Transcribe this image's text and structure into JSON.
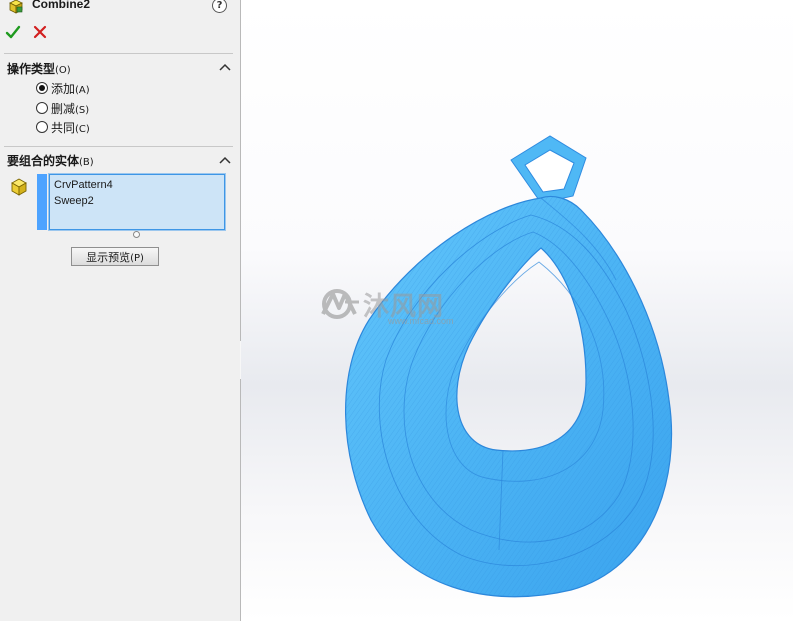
{
  "feature": {
    "title": "Combine2",
    "icon": "combine-feature-icon",
    "help_label": "?"
  },
  "toolbar": {
    "ok_icon": "checkmark-icon",
    "cancel_icon": "close-icon",
    "ok_color": "#1f9a1f",
    "cancel_color": "#d21f1f"
  },
  "operation_group": {
    "title": "操作类型",
    "hotkey": "(O)",
    "options": [
      {
        "label": "添加",
        "hotkey": "(A)",
        "checked": true
      },
      {
        "label": "删减",
        "hotkey": "(S)",
        "checked": false
      },
      {
        "label": "共同",
        "hotkey": "(C)",
        "checked": false
      }
    ]
  },
  "bodies_group": {
    "title": "要组合的实体",
    "hotkey": "(B)",
    "items": [
      "CrvPattern4",
      "Sweep2"
    ],
    "list_color": "#cde4f7"
  },
  "preview_button": {
    "label": "显示预览",
    "hotkey": "(P)"
  },
  "viewport": {
    "model_color": "#4fb8f5",
    "watermark_text": "沐风网",
    "watermark_url": "www.mfcad.com"
  }
}
